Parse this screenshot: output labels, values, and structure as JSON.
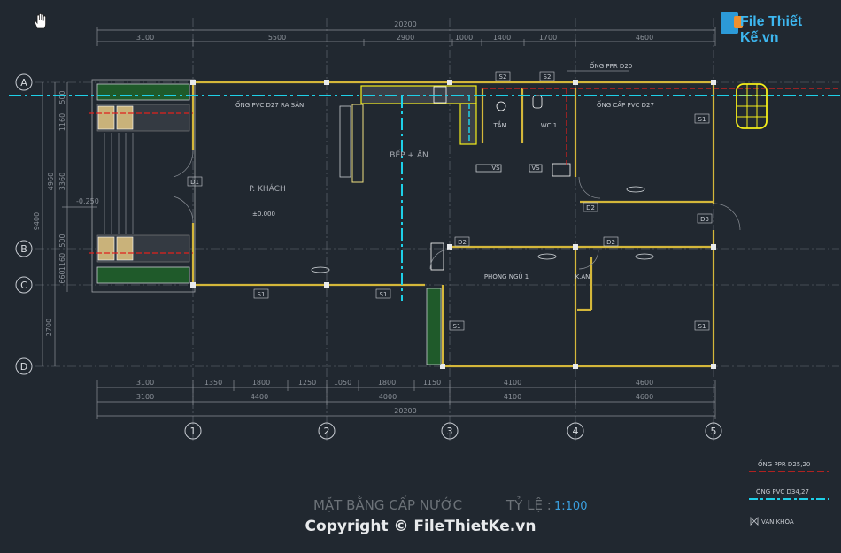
{
  "brand": {
    "name": "File Thiết Kế.vn",
    "icon": "folder-logo-icon"
  },
  "cursor": {
    "icon": "pan-hand-icon"
  },
  "title": {
    "text": "MẶT BẰNG CẤP NƯỚC",
    "scale_label": "TỶ LỆ :",
    "scale_value": "1:100"
  },
  "copyright": "Copyright © FileThietKe.vn",
  "grid": {
    "columns": [
      "1",
      "2",
      "3",
      "4",
      "5"
    ],
    "rows": [
      "A",
      "B",
      "C",
      "D"
    ]
  },
  "dimensions": {
    "top_total": "20200",
    "top_segments": [
      "3100",
      "5500",
      "2900",
      "1000",
      "1400",
      "1700",
      "4600"
    ],
    "bottom_row1": [
      "3100",
      "1350",
      "1800",
      "1250",
      "1050",
      "1800",
      "1150",
      "4100",
      "4600"
    ],
    "bottom_row2": [
      "3100",
      "4400",
      "4000",
      "4100",
      "4600"
    ],
    "bottom_total": "20200",
    "left_outer": [
      "9400",
      "2700"
    ],
    "left_inner": [
      "500",
      "1160",
      "3360",
      "4960",
      "500",
      "1160",
      "660"
    ],
    "level": "-0.250",
    "floor_level": "±0.000"
  },
  "rooms": {
    "living": "P. KHÁCH",
    "kitchen": "BẾP + ĂN",
    "bath": "TẮM",
    "wc": "WC 1",
    "bedroom": "PHÒNG NGỦ 1",
    "closet": "K.AN"
  },
  "pipe_labels": {
    "ppr_d20": "ỐNG PPR D20",
    "pvc_d27_yard": "ỐNG PVC D27 RA SÂN",
    "pvc_d27_supply": "ỐNG CẤP PVC D27"
  },
  "tags": {
    "door": [
      "D1",
      "D2",
      "D2",
      "D2",
      "D3"
    ],
    "window": [
      "S1",
      "S1",
      "S1",
      "S1",
      "S1",
      "S2",
      "S2"
    ],
    "sink": "VS"
  },
  "legend": [
    {
      "label": "ỐNG PPR D25,20",
      "color": "#e0201c",
      "style": "dash"
    },
    {
      "label": "ỐNG PVC D34,27",
      "color": "#1ed0e8",
      "style": "dash"
    },
    {
      "label": "VAN KHÓA",
      "color": "#c8ccd2",
      "style": "symbol"
    }
  ],
  "colors": {
    "wall": "#d4b73a",
    "ppr_pipe": "#e0201c",
    "pvc_pipe": "#1ed0e8",
    "tank": "#f5ee1a",
    "background": "#212830"
  }
}
